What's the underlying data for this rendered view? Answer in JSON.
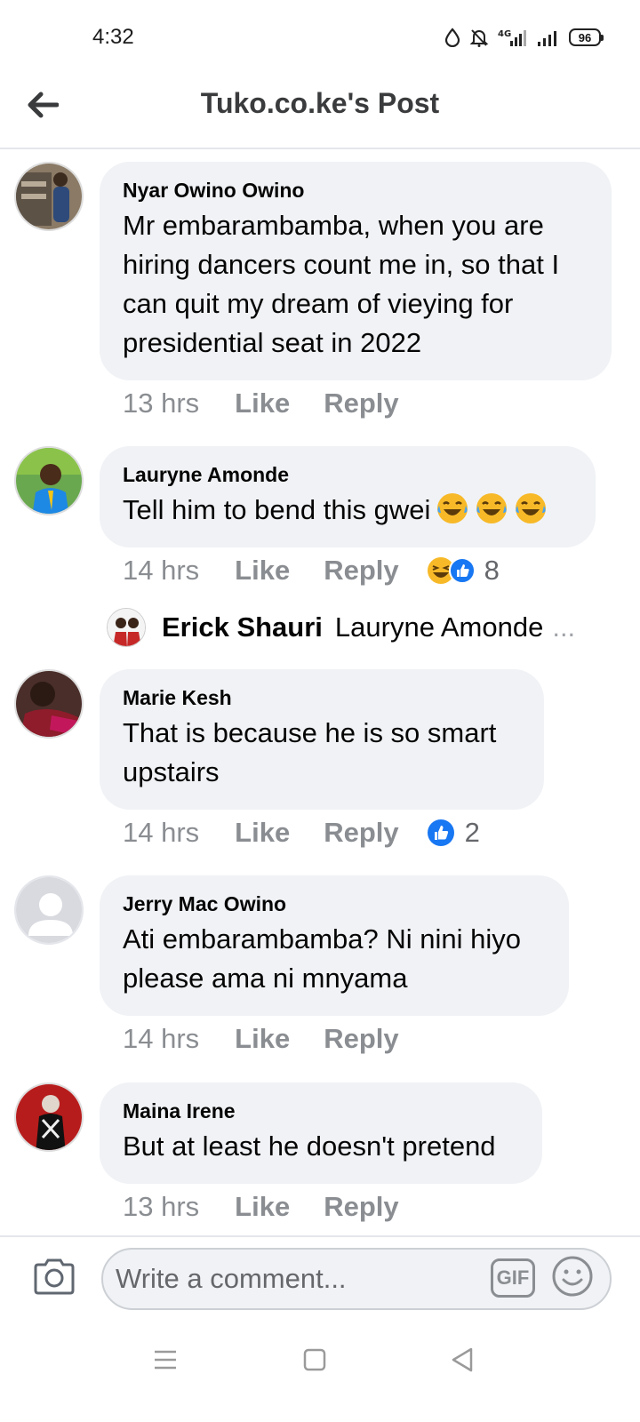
{
  "status_bar": {
    "time": "4:32",
    "network": "4G",
    "battery": "96"
  },
  "header": {
    "title": "Tuko.co.ke's Post"
  },
  "comments": [
    {
      "author": "Nyar Owino Owino",
      "text": "Mr embarambamba, when you are hiring dancers count me in, so that I can quit my dream of vieying for presidential seat in 2022",
      "time": "13 hrs",
      "like": "Like",
      "reply": "Reply"
    },
    {
      "author": "Lauryne Amonde",
      "text": "Tell him to bend this gwei",
      "time": "14 hrs",
      "like": "Like",
      "reply": "Reply",
      "reaction_count": "8"
    },
    {
      "author": "Marie Kesh",
      "text": "That is because he is so smart upstairs",
      "time": "14 hrs",
      "like": "Like",
      "reply": "Reply",
      "reaction_count": "2"
    },
    {
      "author": "Jerry Mac Owino",
      "text": "Ati embarambamba? Ni nini hiyo please ama ni mnyama",
      "time": "14 hrs",
      "like": "Like",
      "reply": "Reply"
    },
    {
      "author": "Maina Irene",
      "text": "But at least he doesn't pretend",
      "time": "13 hrs",
      "like": "Like",
      "reply": "Reply"
    }
  ],
  "reply_preview": {
    "author": "Erick Shauri",
    "snippet": "Lauryne Amonde",
    "ellipsis": "..."
  },
  "composer": {
    "placeholder": "Write a comment...",
    "gif_label": "GIF"
  },
  "colors": {
    "bubble": "#f0f2f5",
    "meta": "#8a8d91",
    "like_blue": "#1877f2",
    "haha_yellow": "#f7b928"
  }
}
